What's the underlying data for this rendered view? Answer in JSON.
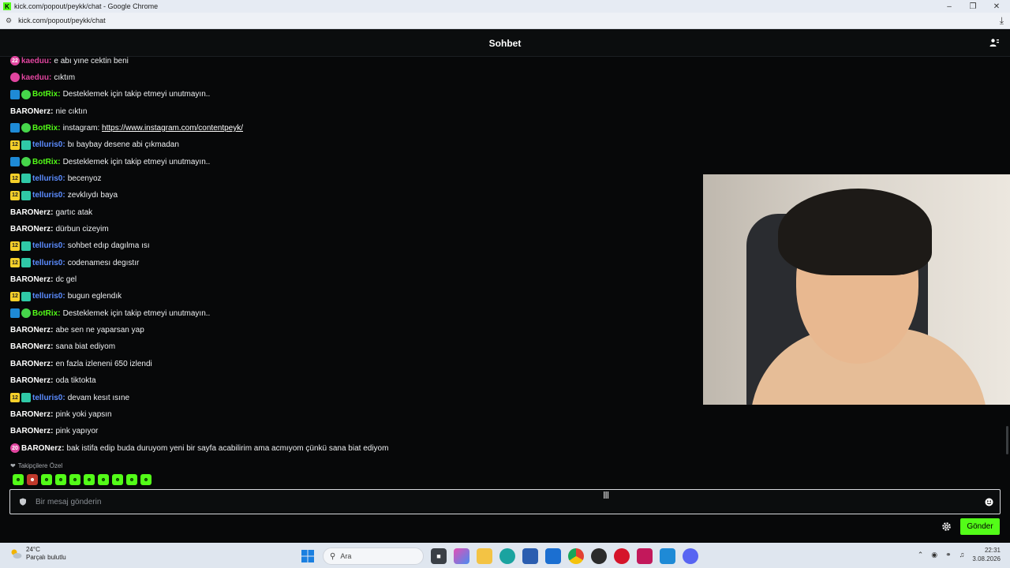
{
  "browser": {
    "window_title": "kick.com/popout/peykk/chat - Google Chrome",
    "url": "kick.com/popout/peykk/chat",
    "favicon_letter": "K"
  },
  "chat": {
    "title": "Sohbet",
    "messages": [
      {
        "badges": [
          "sub"
        ],
        "badge_text": [
          "22"
        ],
        "user": "kaeduu",
        "user_color": "#e1459f",
        "text": "e abı yıne cektin beni"
      },
      {
        "badges": [
          "sub"
        ],
        "badge_text": [
          ""
        ],
        "user": "kaeduu",
        "user_color": "#e1459f",
        "text": "cıktım"
      },
      {
        "badges": [
          "mod",
          "verified"
        ],
        "badge_text": [
          "",
          ""
        ],
        "user": "BotRix",
        "user_color": "#53fc18",
        "text": "Desteklemek için takip etmeyi unutmayın.."
      },
      {
        "badges": [],
        "badge_text": [],
        "user": "BARONerz",
        "user_color": "#ffffff",
        "text": "nie cıktın"
      },
      {
        "badges": [
          "mod",
          "verified"
        ],
        "badge_text": [
          "",
          ""
        ],
        "user": "BotRix",
        "user_color": "#53fc18",
        "text": "instagram: ",
        "link": "https://www.instagram.com/contentpeyk/"
      },
      {
        "badges": [
          "yellow",
          "gift"
        ],
        "badge_text": [
          "12",
          ""
        ],
        "user": "telluris0",
        "user_color": "#5b8cff",
        "text": "bı baybay desene abi çıkmadan"
      },
      {
        "badges": [
          "mod",
          "verified"
        ],
        "badge_text": [
          "",
          ""
        ],
        "user": "BotRix",
        "user_color": "#53fc18",
        "text": "Desteklemek için takip etmeyi unutmayın.."
      },
      {
        "badges": [
          "yellow",
          "gift"
        ],
        "badge_text": [
          "12",
          ""
        ],
        "user": "telluris0",
        "user_color": "#5b8cff",
        "text": "becenyoz"
      },
      {
        "badges": [
          "yellow",
          "gift"
        ],
        "badge_text": [
          "12",
          ""
        ],
        "user": "telluris0",
        "user_color": "#5b8cff",
        "text": "zevklıydı baya"
      },
      {
        "badges": [],
        "badge_text": [],
        "user": "BARONerz",
        "user_color": "#ffffff",
        "text": "gartıc atak"
      },
      {
        "badges": [],
        "badge_text": [],
        "user": "BARONerz",
        "user_color": "#ffffff",
        "text": "dürbun cizeyim"
      },
      {
        "badges": [
          "yellow",
          "gift"
        ],
        "badge_text": [
          "12",
          ""
        ],
        "user": "telluris0",
        "user_color": "#5b8cff",
        "text": "sohbet edıp dagılma ısı"
      },
      {
        "badges": [
          "yellow",
          "gift"
        ],
        "badge_text": [
          "12",
          ""
        ],
        "user": "telluris0",
        "user_color": "#5b8cff",
        "text": "codenamesı degıstır"
      },
      {
        "badges": [],
        "badge_text": [],
        "user": "BARONerz",
        "user_color": "#ffffff",
        "text": "dc gel"
      },
      {
        "badges": [
          "yellow",
          "gift"
        ],
        "badge_text": [
          "12",
          ""
        ],
        "user": "telluris0",
        "user_color": "#5b8cff",
        "text": "bugun eglendık"
      },
      {
        "badges": [
          "mod",
          "verified"
        ],
        "badge_text": [
          "",
          ""
        ],
        "user": "BotRix",
        "user_color": "#53fc18",
        "text": "Desteklemek için takip etmeyi unutmayın.."
      },
      {
        "badges": [],
        "badge_text": [],
        "user": "BARONerz",
        "user_color": "#ffffff",
        "text": "abe sen ne yaparsan yap"
      },
      {
        "badges": [],
        "badge_text": [],
        "user": "BARONerz",
        "user_color": "#ffffff",
        "text": "sana biat ediyom"
      },
      {
        "badges": [],
        "badge_text": [],
        "user": "BARONerz",
        "user_color": "#ffffff",
        "text": "en fazla izleneni 650 izlendi"
      },
      {
        "badges": [],
        "badge_text": [],
        "user": "BARONerz",
        "user_color": "#ffffff",
        "text": "oda tiktokta"
      },
      {
        "badges": [
          "yellow",
          "gift"
        ],
        "badge_text": [
          "12",
          ""
        ],
        "user": "telluris0",
        "user_color": "#5b8cff",
        "text": "devam kesıt ısıne"
      },
      {
        "badges": [],
        "badge_text": [],
        "user": "BARONerz",
        "user_color": "#ffffff",
        "text": "pink yoki yapsın"
      },
      {
        "badges": [],
        "badge_text": [],
        "user": "BARONerz",
        "user_color": "#ffffff",
        "text": "pink yapıyor"
      },
      {
        "badges": [
          "og"
        ],
        "badge_text": [
          "20"
        ],
        "user": "BARONerz",
        "user_color": "#ffffff",
        "text": "bak istifa edip buda duruyom yeni bir sayfa acabilirim ama acmıyom çünkü sana biat ediyom"
      }
    ],
    "followers_only_label": "Takipçilere Özel",
    "emotes": [
      "emote-1",
      "emote-2",
      "emote-3",
      "emote-4",
      "emote-5",
      "emote-6",
      "emote-7",
      "emote-8",
      "emote-9",
      "emote-10"
    ],
    "input_placeholder": "Bir mesaj gönderin",
    "send_label": "Gönder"
  },
  "taskbar": {
    "temperature": "24°C",
    "weather": "Parçalı bulutlu",
    "search_placeholder": "Ara",
    "time": "22:31",
    "date": "3.08.2026"
  },
  "colors": {
    "accent": "#53fc18",
    "background": "#070809"
  }
}
